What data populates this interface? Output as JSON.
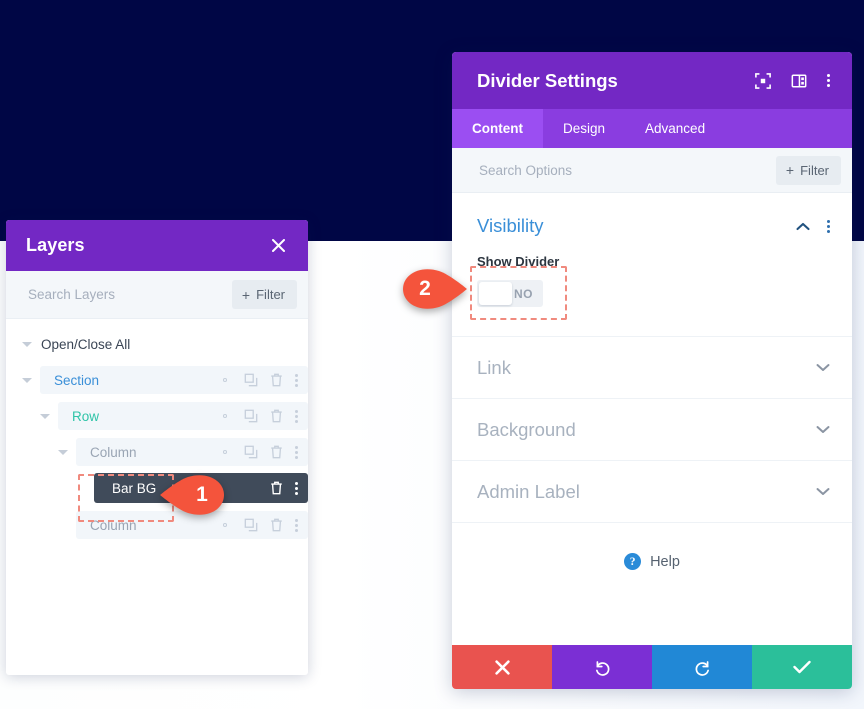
{
  "canvas": {
    "dark_background_color": "#000645",
    "light_background_color": "#f4f7fc"
  },
  "layers_panel": {
    "title": "Layers",
    "close_icon": "close-icon",
    "search": {
      "placeholder": "Search Layers",
      "value": ""
    },
    "filter_button": {
      "label": "Filter",
      "plus": "+"
    },
    "open_close_all": "Open/Close All",
    "row_actions": [
      "gear-icon",
      "duplicate-icon",
      "trash-icon",
      "kebab-menu-icon"
    ],
    "tree": [
      {
        "label": "Section",
        "type": "section",
        "depth": 1,
        "color": "#3a8fd8"
      },
      {
        "label": "Row",
        "type": "row",
        "depth": 2,
        "color": "#2fc4a8"
      },
      {
        "label": "Column",
        "type": "column",
        "depth": 3,
        "color": "#9aa5b4"
      },
      {
        "label": "Bar BG",
        "type": "module",
        "depth": 4,
        "color": "#ffffff",
        "highlighted": true
      },
      {
        "label": "Column",
        "type": "column",
        "depth": 3,
        "color": "#9aa5b4"
      }
    ]
  },
  "settings_modal": {
    "title": "Divider Settings",
    "header_icons": [
      "fullscreen-icon",
      "split-view-icon",
      "kebab-menu-icon"
    ],
    "tabs": [
      {
        "label": "Content",
        "active": true
      },
      {
        "label": "Design",
        "active": false
      },
      {
        "label": "Advanced",
        "active": false
      }
    ],
    "search": {
      "placeholder": "Search Options",
      "value": ""
    },
    "filter_button": {
      "label": "Filter",
      "plus": "+"
    },
    "groups": [
      {
        "title": "Visibility",
        "expanded": true,
        "fields": [
          {
            "label": "Show Divider",
            "type": "toggle",
            "value": "NO",
            "state": "off"
          }
        ]
      },
      {
        "title": "Link",
        "expanded": false
      },
      {
        "title": "Background",
        "expanded": false
      },
      {
        "title": "Admin Label",
        "expanded": false
      }
    ],
    "help": {
      "label": "Help",
      "icon_glyph": "?"
    },
    "footer_buttons": [
      {
        "name": "cancel",
        "icon": "close-icon",
        "color": "#e9534f"
      },
      {
        "name": "undo",
        "icon": "undo-icon",
        "color": "#7b2fd4"
      },
      {
        "name": "redo",
        "icon": "redo-icon",
        "color": "#2188d6"
      },
      {
        "name": "save",
        "icon": "check-icon",
        "color": "#2bbf9a"
      }
    ]
  },
  "callouts": [
    {
      "number": "1",
      "points_to": "bar-bg-layer-row",
      "color": "#f4543c"
    },
    {
      "number": "2",
      "points_to": "show-divider-toggle",
      "color": "#f4543c"
    }
  ]
}
